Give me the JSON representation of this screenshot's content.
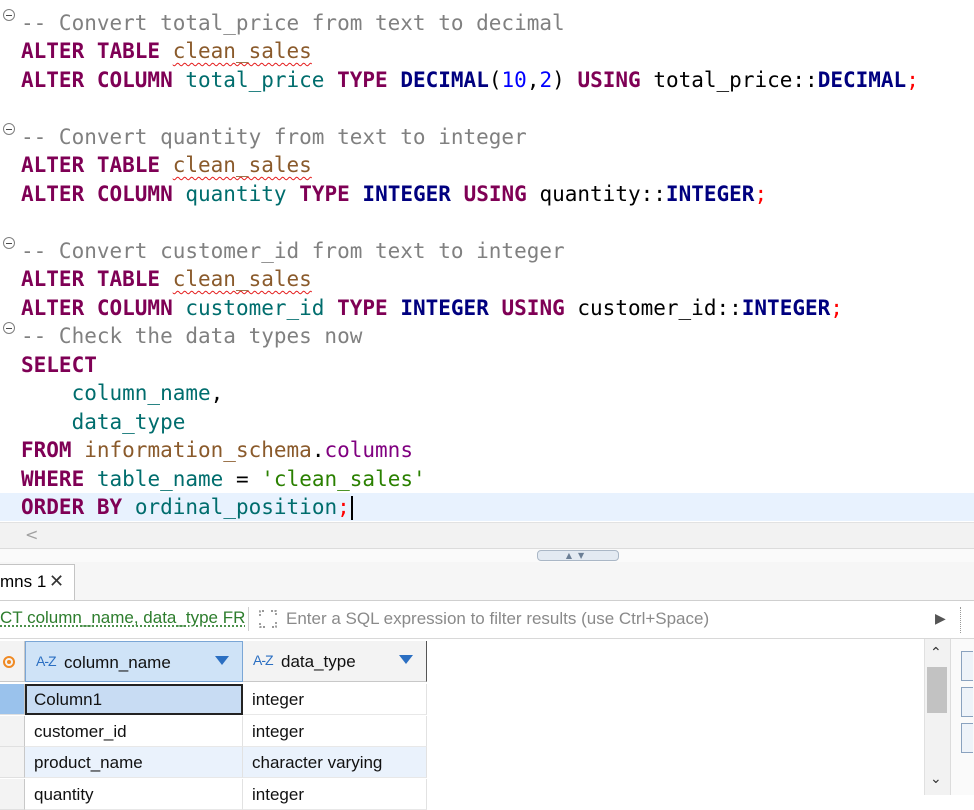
{
  "editor": {
    "lines": [
      {
        "comment": "-- Convert total_price from text to decimal"
      },
      {
        "kw1": "ALTER TABLE",
        "table": "clean_sales"
      },
      {
        "kw1": "ALTER COLUMN",
        "col": "total_price",
        "kw2": "TYPE",
        "type": "DECIMAL",
        "open": "(",
        "n1": "10",
        "comma": ",",
        "n2": "2",
        "close": ")",
        "kw3": "USING",
        "expr": "total_price",
        "cast": "::",
        "type2": "DECIMAL",
        "semi": ";"
      },
      {
        "comment": "-- Convert quantity from text to integer"
      },
      {
        "kw1": "ALTER TABLE",
        "table": "clean_sales"
      },
      {
        "kw1": "ALTER COLUMN",
        "col": "quantity",
        "kw2": "TYPE",
        "type": "INTEGER",
        "kw3": "USING",
        "expr": "quantity",
        "cast": "::",
        "type2": "INTEGER",
        "semi": ";"
      },
      {
        "comment": "-- Convert customer_id from text to integer"
      },
      {
        "kw1": "ALTER TABLE",
        "table": "clean_sales"
      },
      {
        "kw1": "ALTER COLUMN",
        "col": "customer_id",
        "kw2": "TYPE",
        "type": "INTEGER",
        "kw3": "USING",
        "expr": "customer_id",
        "cast": "::",
        "type2": "INTEGER",
        "semi": ";"
      },
      {
        "comment": "-- Check the data types now"
      },
      {
        "kw1": "SELECT"
      },
      {
        "indent": "    ",
        "col": "column_name",
        "punct": ","
      },
      {
        "indent": "    ",
        "col": "data_type"
      },
      {
        "kw1": "FROM",
        "schema": "information_schema",
        "dot": ".",
        "prop": "columns"
      },
      {
        "kw1": "WHERE",
        "col": "table_name",
        "eq": "=",
        "str": "'clean_sales'"
      },
      {
        "kw1": "ORDER BY",
        "col": "ordinal_position",
        "semi": ";"
      }
    ]
  },
  "results": {
    "tab_label": "mns 1",
    "tab_close": "✕",
    "filter_query": "CT column_name, data_type FR",
    "filter_placeholder": "Enter a SQL expression to filter results (use Ctrl+Space)",
    "columns": [
      {
        "icon": "A-Z",
        "name": "column_name"
      },
      {
        "icon": "A-Z",
        "name": "data_type"
      }
    ],
    "rows": [
      {
        "column_name": "Column1",
        "data_type": "integer"
      },
      {
        "column_name": "customer_id",
        "data_type": "integer"
      },
      {
        "column_name": "product_name",
        "data_type": "character varying"
      },
      {
        "column_name": "quantity",
        "data_type": "integer"
      }
    ]
  },
  "icons": {
    "fold": "fold-collapse-icon",
    "expand": "expand-icon",
    "play": "play-icon",
    "corner": "record-icon"
  },
  "colors": {
    "keyword": "#7f0055",
    "type": "#00007f",
    "comment": "#808080",
    "string": "#2a8000",
    "number": "#0000ff",
    "current_line": "#e8f2fe",
    "selection": "#c8dcf3"
  }
}
